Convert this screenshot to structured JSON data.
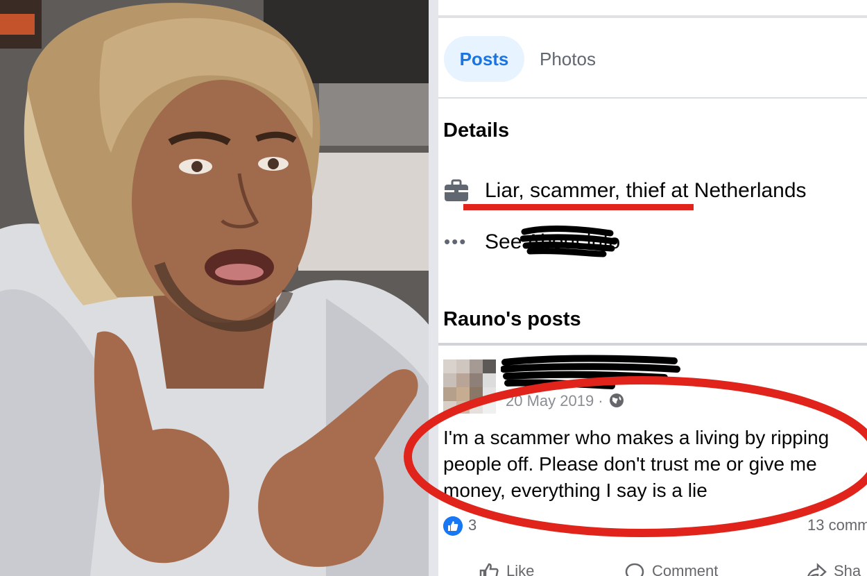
{
  "tabs": [
    {
      "label": "Posts",
      "active": true
    },
    {
      "label": "Photos",
      "active": false
    }
  ],
  "details": {
    "title": "Details",
    "work_text": "Liar, scammer, thief at Netherlands",
    "see_about_text": "See                   About info"
  },
  "posts_section": {
    "title": "Rauno's posts"
  },
  "post": {
    "date": "20 May 2019 ·",
    "text": "I'm a scammer who makes a living by ripping\npeople off. Please don't trust me or give me\nmoney, everything I say is a lie",
    "like_count": "3",
    "comment_count": "13 comm"
  },
  "actions": {
    "like": "Like",
    "comment": "Comment",
    "share": "Sha"
  },
  "icons": {
    "work": "briefcase-icon",
    "more": "more-dots-icon",
    "globe": "globe-icon",
    "like_badge": "thumbs-up-icon"
  },
  "colors": {
    "accent_blue": "#1b74e4",
    "tab_active_bg": "#e7f3ff",
    "annotation_red": "#e0241b"
  }
}
